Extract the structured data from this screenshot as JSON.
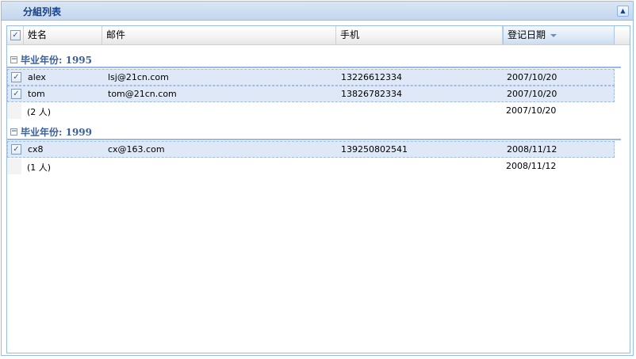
{
  "panel": {
    "title": "分組列表"
  },
  "grid": {
    "columns": [
      {
        "label": "姓名"
      },
      {
        "label": "邮件"
      },
      {
        "label": "手机"
      },
      {
        "label": "登记日期"
      }
    ],
    "sorted_column": "登记日期",
    "sort_direction": "desc",
    "groups": [
      {
        "label": "毕业年份: 1995",
        "collapsed": false,
        "rows": [
          {
            "checked": true,
            "name": "alex",
            "email": "lsj@21cn.com",
            "phone": "13226612334",
            "date": "2007/10/20"
          },
          {
            "checked": true,
            "name": "tom",
            "email": "tom@21cn.com",
            "phone": "13826782334",
            "date": "2007/10/20"
          }
        ],
        "summary": {
          "count": "(2 人)",
          "date": "2007/10/20"
        }
      },
      {
        "label": "毕业年份: 1999",
        "collapsed": false,
        "rows": [
          {
            "checked": true,
            "name": "cx8",
            "email": "cx@163.com",
            "phone": "139250802541",
            "date": "2008/11/12"
          }
        ],
        "summary": {
          "count": "(1 人)",
          "date": "2008/11/12"
        }
      }
    ]
  },
  "colors": {
    "header_blue": "#15428b",
    "group_blue": "#3b5f97",
    "selected_row": "#dfe8f6",
    "border": "#99bbe8"
  },
  "icons": {
    "collapse": "double-chevron-up-icon",
    "group_toggle": "minus-box-icon",
    "sort": "sort-desc-arrow-icon",
    "checkbox": "checkbox-checked-icon"
  }
}
